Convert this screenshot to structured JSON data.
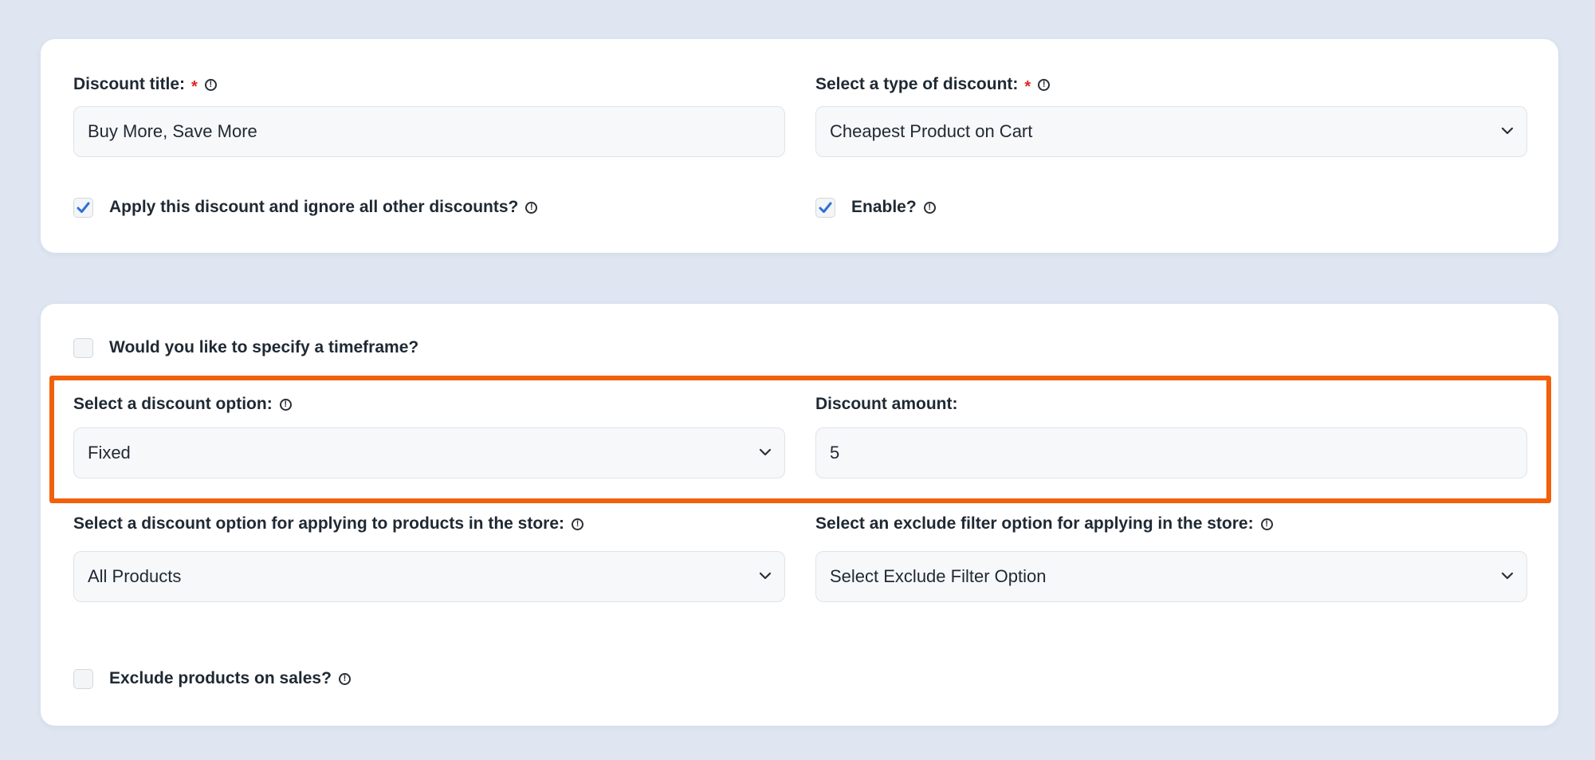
{
  "card_general": {
    "discount_title": {
      "label": "Discount title:",
      "required_mark": "*",
      "value": "Buy More, Save More"
    },
    "discount_type": {
      "label": "Select a type of discount:",
      "required_mark": "*",
      "selected": "Cheapest Product on Cart"
    },
    "apply_exclusive": {
      "label": "Apply this discount and ignore all other discounts?",
      "checked": true
    },
    "enable": {
      "label": "Enable?",
      "checked": true
    }
  },
  "card_options": {
    "timeframe": {
      "label": "Would you like to specify a timeframe?",
      "checked": false
    },
    "discount_option": {
      "label": "Select a discount option:",
      "selected": "Fixed"
    },
    "discount_amount": {
      "label": "Discount amount:",
      "value": "5"
    },
    "apply_products": {
      "label": "Select a discount option for applying to products in the store:",
      "selected": "All Products"
    },
    "exclude_filter": {
      "label": "Select an exclude filter option for applying in the store:",
      "selected": "Select Exclude Filter Option"
    },
    "exclude_sales": {
      "label": "Exclude products on sales?",
      "checked": false
    }
  },
  "help_glyph": "!",
  "icons": {
    "help": "info-circle-icon",
    "dropdown": "chevron-down-icon",
    "check": "check-icon"
  },
  "colors": {
    "page_background": "#dfe6f2",
    "card_background": "#ffffff",
    "highlight_border": "#f2600c",
    "required_mark": "#e02424",
    "checkmark": "#2e6fd8"
  }
}
